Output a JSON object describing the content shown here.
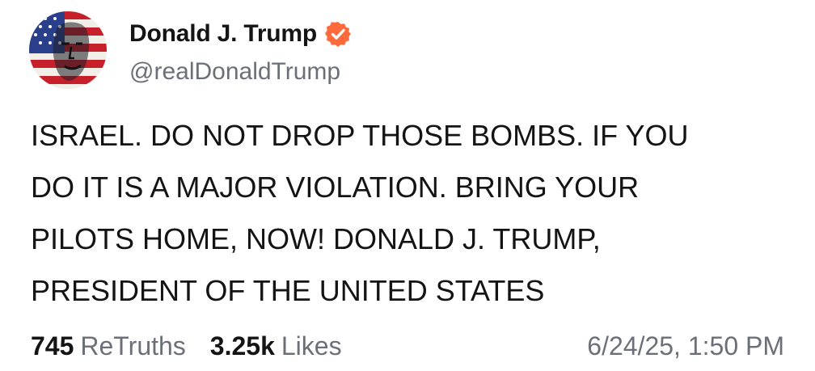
{
  "author": {
    "display_name": "Donald J. Trump",
    "handle": "@realDonaldTrump",
    "verified": true,
    "verified_color": "#ff6a3d",
    "avatar_icon": "flag-portrait-avatar"
  },
  "post": {
    "text": "ISRAEL. DO NOT DROP THOSE BOMBS. IF YOU\nDO IT IS A MAJOR VIOLATION. BRING YOUR\nPILOTS HOME, NOW!  DONALD J. TRUMP,\nPRESIDENT OF THE UNITED STATES"
  },
  "stats": {
    "retruths_count": "745",
    "retruths_label": "ReTruths",
    "likes_count": "3.25k",
    "likes_label": "Likes",
    "timestamp": "6/24/25, 1:50 PM"
  }
}
